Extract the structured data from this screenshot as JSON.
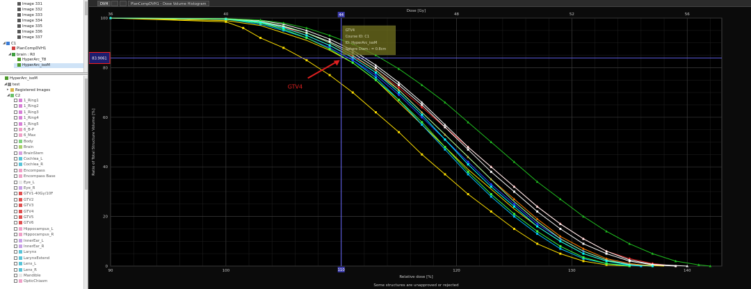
{
  "tabs": [
    {
      "label": "DVH",
      "active": true
    },
    {
      "label": "",
      "active": false
    },
    {
      "label": "",
      "active": false
    },
    {
      "label": "PlanCompDVH1 - Dose Volume Histogram",
      "active": false
    }
  ],
  "top_tree": [
    {
      "label": "Image 331",
      "indent": 2,
      "icon": "image-icon"
    },
    {
      "label": "Image 332",
      "indent": 2,
      "icon": "image-icon"
    },
    {
      "label": "Image 333",
      "indent": 2,
      "icon": "image-icon"
    },
    {
      "label": "Image 334",
      "indent": 2,
      "icon": "image-icon"
    },
    {
      "label": "Image 335",
      "indent": 2,
      "icon": "image-icon"
    },
    {
      "label": "Image 336",
      "indent": 2,
      "icon": "image-icon"
    },
    {
      "label": "Image 337",
      "indent": 2,
      "icon": "image-icon"
    },
    {
      "label": "C1",
      "indent": 0,
      "icon": "course-icon",
      "toggle": "◢"
    },
    {
      "label": "PlanCompDVH1",
      "indent": 1,
      "icon": "plan-comp-icon"
    },
    {
      "label": "brain : R0",
      "indent": 1,
      "icon": "prescription-icon",
      "toggle": "◢"
    },
    {
      "label": "HyperArc_T8",
      "indent": 2,
      "icon": "plan-icon"
    },
    {
      "label": "HyperArc_isoM",
      "indent": 2,
      "icon": "plan-icon",
      "selected": true
    }
  ],
  "bottom_tree": {
    "plan": "HyperArc_isoM",
    "image": "test",
    "registered": "Registered Images",
    "structure_set": "C2",
    "structures": [
      {
        "name": "1_Ring1",
        "color": "#d77fd7"
      },
      {
        "name": "1_Ring2",
        "color": "#d77fd7"
      },
      {
        "name": "1_Ring3",
        "color": "#d77fd7"
      },
      {
        "name": "1_Ring4",
        "color": "#d77fd7"
      },
      {
        "name": "1_Ring5",
        "color": "#d77fd7"
      },
      {
        "name": "6_B-P",
        "color": "#f0a0c8"
      },
      {
        "name": "6_Max",
        "color": "#f0a0c8"
      },
      {
        "name": "Body",
        "color": "#7ed37e"
      },
      {
        "name": "Brain",
        "color": "#a8d06a"
      },
      {
        "name": "BrainStem",
        "color": "#d7a0e0"
      },
      {
        "name": "Cochlea_L",
        "color": "#58c4d8"
      },
      {
        "name": "Cochlea_R",
        "color": "#58c4d8"
      },
      {
        "name": "Encompass",
        "color": "#f0a0c8"
      },
      {
        "name": "Encompass Base",
        "color": "#f0a0c8"
      },
      {
        "name": "Eye_L",
        "color": "#e8e8e8"
      },
      {
        "name": "Eye_R",
        "color": "#c8a0e8"
      },
      {
        "name": "GTV1-40Gy/10F",
        "color": "#e05050"
      },
      {
        "name": "GTV2",
        "color": "#e05050"
      },
      {
        "name": "GTV3",
        "color": "#e05050"
      },
      {
        "name": "GTV4",
        "color": "#e05050"
      },
      {
        "name": "GTV5",
        "color": "#e05050"
      },
      {
        "name": "GTV6",
        "color": "#e05050"
      },
      {
        "name": "Hippocampus_L",
        "color": "#f0a0c8"
      },
      {
        "name": "Hippocampus_R",
        "color": "#f0a0c8"
      },
      {
        "name": "InnerEar_L",
        "color": "#c8a0e8"
      },
      {
        "name": "InnerEar_R",
        "color": "#c8a0e8"
      },
      {
        "name": "Larynx",
        "color": "#58c4d8"
      },
      {
        "name": "LarynxExtend",
        "color": "#58c4d8"
      },
      {
        "name": "Lens_L",
        "color": "#58c4d8"
      },
      {
        "name": "Lens_R",
        "color": "#58c4d8"
      },
      {
        "name": "Mandible",
        "color": "#e8e8e8"
      },
      {
        "name": "OpticChiasm",
        "color": "#f0a0c8"
      }
    ]
  },
  "tooltip": {
    "line1": "GTV4",
    "line2": "Course ID: C1",
    "line3": "ID: HyperArc_isoM",
    "line4": "Sphere Diam.: = 0.8cm"
  },
  "y_readout": "83.9061",
  "cursor_x_label": "110",
  "cursor_top_label": "44",
  "annotation": "GTV4",
  "footer": "Some structures are unapproved or rejected",
  "chart_data": {
    "type": "line",
    "xlabel": "Relative dose [%]",
    "ylabel": "Ratio of Total Structure Volume [%]",
    "x2label": "Dose [Gy]",
    "xlim": [
      90,
      143
    ],
    "ylim": [
      0,
      100
    ],
    "x_ticks": [
      90,
      100,
      110,
      120,
      130,
      140
    ],
    "y_ticks": [
      0,
      20,
      40,
      60,
      80,
      100
    ],
    "x2_ticks": [
      36,
      40,
      44,
      48,
      52,
      56
    ],
    "x2_tick_rel": [
      90,
      100,
      110,
      120,
      130,
      140
    ],
    "cursor": {
      "x": 110,
      "y": 83.9061
    },
    "series": [
      {
        "color": "#ffe000",
        "marker": "square",
        "x": [
          90,
          100,
          101.5,
          103,
          105,
          107,
          109,
          111,
          113,
          115,
          117,
          119,
          121,
          123,
          125,
          127,
          129,
          131,
          133,
          135
        ],
        "y": [
          100,
          98.5,
          96,
          92,
          88,
          83,
          77,
          70,
          62,
          54,
          45,
          37,
          29,
          22,
          15,
          9,
          5,
          2,
          0.5,
          0
        ]
      },
      {
        "color": "#ffe000",
        "marker": "none",
        "x": [
          90,
          100,
          103,
          105,
          107,
          109,
          111,
          113,
          115,
          117,
          119,
          121,
          123,
          125,
          127,
          129,
          131,
          133,
          136,
          138
        ],
        "y": [
          100,
          99,
          97,
          94,
          91,
          87,
          82,
          75,
          66,
          57,
          48,
          39,
          31,
          23,
          16,
          10,
          5,
          2,
          0.5,
          0
        ]
      },
      {
        "color": "#00c0ff",
        "marker": "square",
        "x": [
          90,
          100,
          103,
          105,
          107,
          109,
          111,
          113,
          115,
          117,
          119,
          121,
          123,
          125,
          127,
          129,
          131,
          133,
          136
        ],
        "y": [
          100,
          99.5,
          97.5,
          95,
          92,
          88,
          83,
          76,
          67,
          57,
          47,
          37,
          28,
          20,
          13,
          7,
          3,
          1,
          0
        ]
      },
      {
        "color": "#2040ff",
        "marker": "diamond",
        "x": [
          90,
          100,
          103,
          105,
          107,
          109,
          111,
          113,
          115,
          117,
          119,
          121,
          123,
          125,
          127,
          129,
          131,
          133,
          135,
          137
        ],
        "y": [
          100,
          99.5,
          98,
          95.5,
          92,
          88,
          83,
          77,
          69,
          60,
          51,
          42,
          33,
          25,
          17,
          11,
          6,
          2.5,
          0.8,
          0
        ]
      },
      {
        "color": "#e02020",
        "marker": "diamond",
        "x": [
          90,
          100,
          103,
          105,
          107,
          109,
          111,
          113,
          115,
          117,
          119,
          121,
          123,
          125,
          127,
          129,
          131,
          133,
          135,
          137,
          139
        ],
        "y": [
          100,
          99.5,
          98.5,
          96.5,
          93,
          89,
          84.5,
          79,
          72,
          64,
          56,
          48,
          40,
          32,
          24,
          17,
          11,
          6,
          3,
          1,
          0
        ]
      },
      {
        "color": "#ff8000",
        "marker": "triangle",
        "x": [
          90,
          100,
          103,
          105,
          107,
          109,
          111,
          113,
          115,
          117,
          119,
          121,
          123,
          125,
          127,
          129,
          131,
          133,
          135,
          137
        ],
        "y": [
          100,
          99.5,
          98,
          96,
          93,
          89,
          84,
          78,
          71,
          62,
          53,
          44,
          35,
          27,
          19,
          12,
          7,
          3,
          1,
          0
        ]
      },
      {
        "color": "#ffffff",
        "marker": "square",
        "x": [
          90,
          100,
          103,
          105,
          107,
          109,
          111,
          113,
          115,
          117,
          119,
          121,
          123,
          125,
          127,
          129,
          131,
          133,
          135,
          137,
          139
        ],
        "y": [
          100,
          99.7,
          98.5,
          96.5,
          94,
          90.5,
          86,
          80,
          73,
          65,
          56,
          47,
          38,
          30,
          22,
          15,
          9,
          5,
          2,
          0.5,
          0
        ]
      },
      {
        "color": "#ffffff",
        "marker": "triangle",
        "x": [
          90,
          100,
          103,
          105,
          107,
          109,
          111,
          113,
          115,
          117,
          119,
          121,
          123,
          125,
          127,
          129,
          131,
          133,
          135,
          137,
          140
        ],
        "y": [
          100,
          99.7,
          99,
          97.5,
          95,
          91.5,
          87,
          81,
          74,
          66,
          57,
          48,
          40,
          32,
          24,
          17,
          11,
          6,
          2.5,
          0.7,
          0
        ]
      },
      {
        "color": "#20c020",
        "marker": "triangle",
        "x": [
          90,
          100,
          103,
          105,
          107,
          109,
          111,
          113,
          115,
          117,
          119,
          121,
          123,
          125,
          127,
          129,
          131,
          133,
          135,
          137,
          139,
          141,
          142
        ],
        "y": [
          100,
          99.8,
          99.2,
          98,
          96,
          93,
          89.5,
          85,
          79.5,
          73,
          66,
          58,
          50,
          42,
          34,
          27,
          20,
          14,
          9,
          5,
          2,
          0.5,
          0
        ]
      },
      {
        "color": "#40ff40",
        "marker": "square",
        "x": [
          90,
          100,
          103,
          105,
          107,
          109,
          111,
          113,
          115,
          117,
          119,
          121,
          123,
          125,
          127,
          129,
          131,
          133,
          135
        ],
        "y": [
          100,
          99.5,
          98,
          95.5,
          92,
          87.5,
          82,
          75,
          67,
          58,
          48,
          38,
          29,
          21,
          14,
          8,
          3.5,
          1,
          0
        ]
      },
      {
        "color": "#00ffff",
        "marker": "square",
        "x": [
          90,
          100,
          103,
          105,
          107,
          109,
          111,
          113,
          115,
          117,
          119,
          121,
          123,
          125,
          127,
          129,
          131,
          133,
          135,
          137
        ],
        "y": [
          100,
          99.6,
          98.3,
          96,
          93,
          89,
          84,
          78,
          70,
          61,
          51,
          41,
          32,
          24,
          16,
          10,
          5,
          2,
          0.5,
          0
        ]
      },
      {
        "color": "#a0ffa0",
        "marker": "none",
        "x": [
          90,
          100,
          103,
          105,
          107,
          109,
          111,
          113,
          115,
          117,
          119,
          121,
          123,
          125,
          127,
          129,
          131,
          133,
          135,
          137
        ],
        "y": [
          100,
          99.7,
          98.6,
          96.8,
          94,
          90,
          85,
          79,
          71,
          62,
          53,
          44,
          35,
          26,
          18,
          11,
          6,
          2.5,
          0.6,
          0
        ]
      }
    ]
  },
  "colors": {
    "background": "#000000",
    "grid": "#3a3a3a",
    "axis_text": "#c8c8c8",
    "cursor": "#6a6aff",
    "annotation": "#e02020"
  }
}
